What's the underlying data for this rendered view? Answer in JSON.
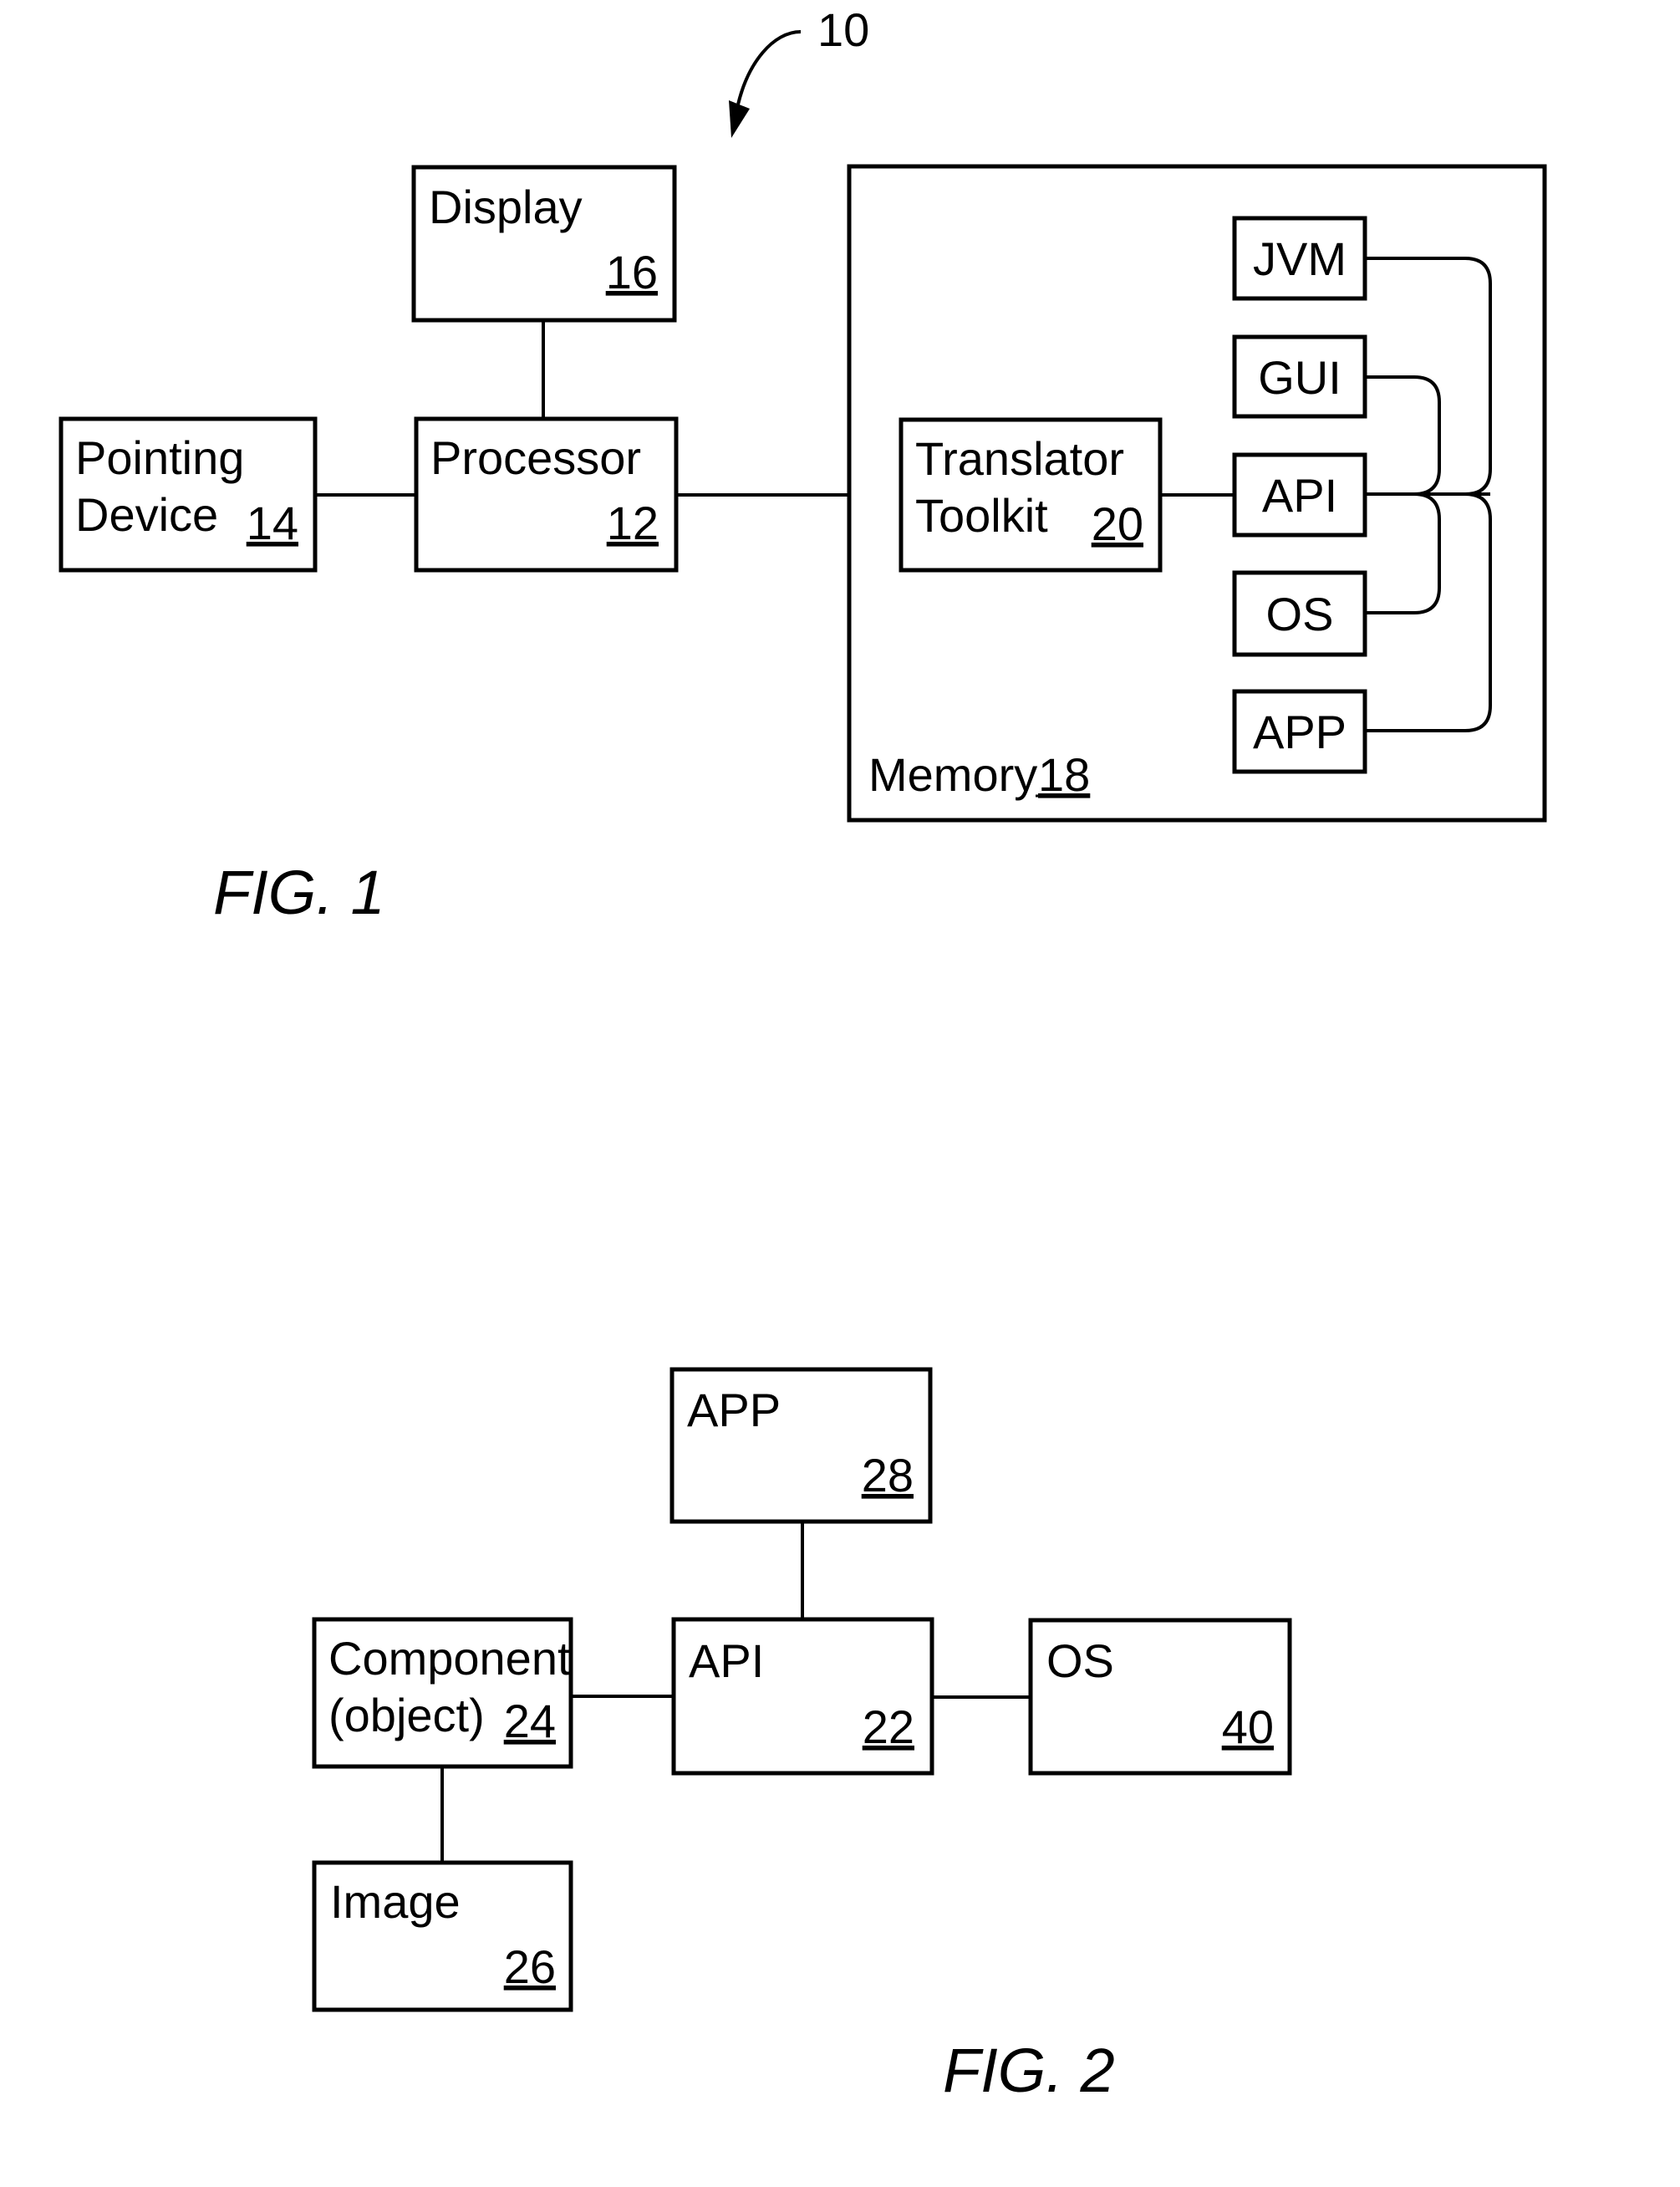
{
  "figure1": {
    "caption": "FIG. 1",
    "system_ref": "10",
    "display": {
      "label": "Display",
      "ref": "16"
    },
    "processor": {
      "label": "Processor",
      "ref": "12"
    },
    "pointing_device": {
      "label_line1": "Pointing",
      "label_line2": "Device",
      "ref": "14"
    },
    "memory": {
      "label": "Memory",
      "ref": "18"
    },
    "translator_toolkit": {
      "label_line1": "Translator",
      "label_line2": "Toolkit",
      "ref": "20"
    },
    "stack": [
      {
        "id": "jvm",
        "label": "JVM"
      },
      {
        "id": "gui",
        "label": "GUI"
      },
      {
        "id": "api",
        "label": "API"
      },
      {
        "id": "os",
        "label": "OS"
      },
      {
        "id": "app",
        "label": "APP"
      }
    ]
  },
  "figure2": {
    "caption": "FIG. 2",
    "app": {
      "label": "APP",
      "ref": "28"
    },
    "api": {
      "label": "API",
      "ref": "22"
    },
    "os": {
      "label": "OS",
      "ref": "40"
    },
    "component": {
      "label_line1": "Component",
      "label_line2": "(object)",
      "ref": "24"
    },
    "image": {
      "label": "Image",
      "ref": "26"
    }
  }
}
